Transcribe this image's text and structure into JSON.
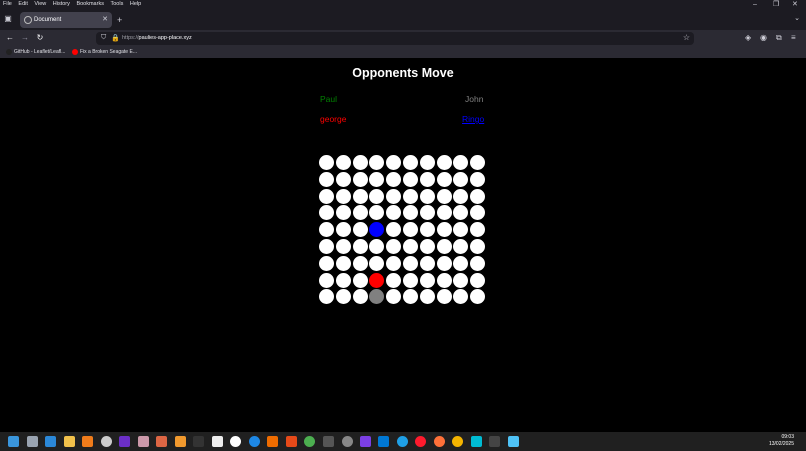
{
  "browser": {
    "menu": [
      "File",
      "Edit",
      "View",
      "History",
      "Bookmarks",
      "Tools",
      "Help"
    ],
    "tab_title": "Document",
    "url_scheme": "https://",
    "url_host": "paulies-app-place.xyz",
    "bookmarks": [
      "GitHub - Leaflet/Leafl...",
      "Fix a Broken Seagate E..."
    ]
  },
  "game": {
    "status": "Opponents Move",
    "players": {
      "top_left": "Paul",
      "top_right": "John",
      "bottom_left": "george",
      "bottom_right": "Ringo"
    },
    "board": {
      "columns": 10,
      "rows": 9,
      "pieces": [
        {
          "row": 4,
          "col": 3,
          "color": "#0000ff"
        },
        {
          "row": 7,
          "col": 3,
          "color": "#ff0000"
        },
        {
          "row": 8,
          "col": 3,
          "color": "#808080"
        }
      ]
    },
    "colors": {
      "paul": "#008000",
      "john": "#808080",
      "george": "#ff0000",
      "ringo": "#0000ff",
      "empty": "#ffffff"
    }
  },
  "taskbar": {
    "time": "09:03",
    "date": "13/02/2025"
  }
}
